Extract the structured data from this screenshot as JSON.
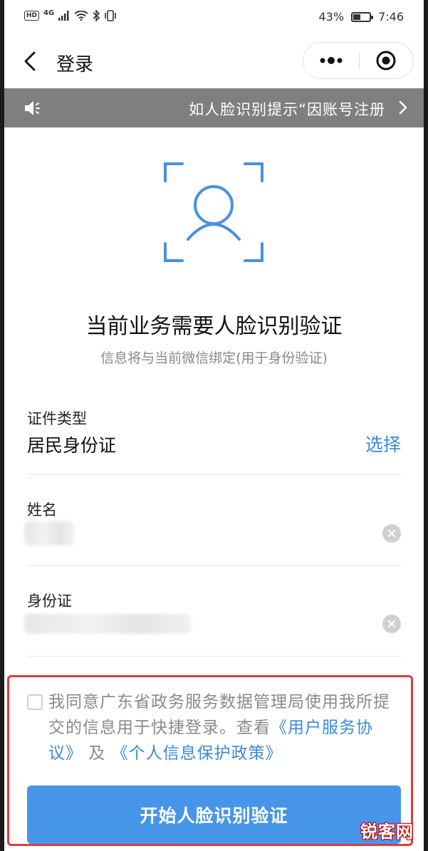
{
  "status_bar": {
    "hd": "HD",
    "network": "4G",
    "battery_percent": "43%",
    "battery_level": 0.43,
    "time": "7:46"
  },
  "nav": {
    "title": "登录",
    "icons": {
      "back": "chevron-left-icon",
      "more": "more-dots-icon",
      "close": "record-circle-icon"
    }
  },
  "notice": {
    "text": "如人脸识别提示“因账号注册",
    "icon": "speaker-icon"
  },
  "face_section": {
    "headline": "当前业务需要人脸识别验证",
    "subline": "信息将与当前微信绑定(用于身份验证)",
    "icon_color": "#4a90e2"
  },
  "form": {
    "id_type": {
      "label": "证件类型",
      "value": "居民身份证",
      "select_label": "选择"
    },
    "name": {
      "label": "姓名"
    },
    "id_number": {
      "label": "身份证"
    }
  },
  "agreement": {
    "text": "我同意广东省政务服务数据管理局使用我所提交的信息用于快捷登录。查看",
    "link1": "《用户服务协议》",
    "and": "及",
    "link2": "《个人信息保护政策》"
  },
  "action": {
    "start_label": "开始人脸识别验证"
  },
  "watermark": "锐客网",
  "colors": {
    "accent": "#4795e8",
    "link": "#3b8ad9",
    "notice_bg": "#7f7f7f",
    "highlight": "#e23a3a"
  }
}
